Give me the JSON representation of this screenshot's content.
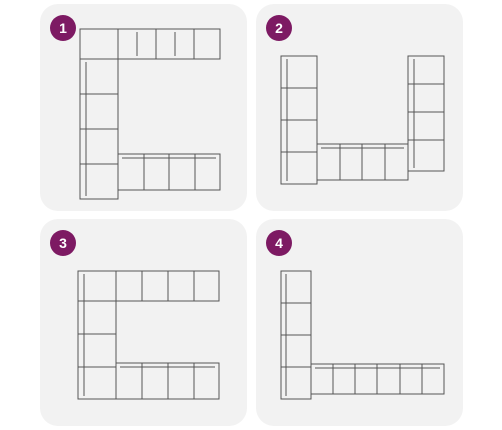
{
  "options": [
    {
      "number": "1"
    },
    {
      "number": "2"
    },
    {
      "number": "3"
    },
    {
      "number": "4"
    }
  ],
  "colors": {
    "card_background": "#f2f2f2",
    "badge": "#7d1a63",
    "badge_text": "#ffffff",
    "line_art": "#555555"
  }
}
